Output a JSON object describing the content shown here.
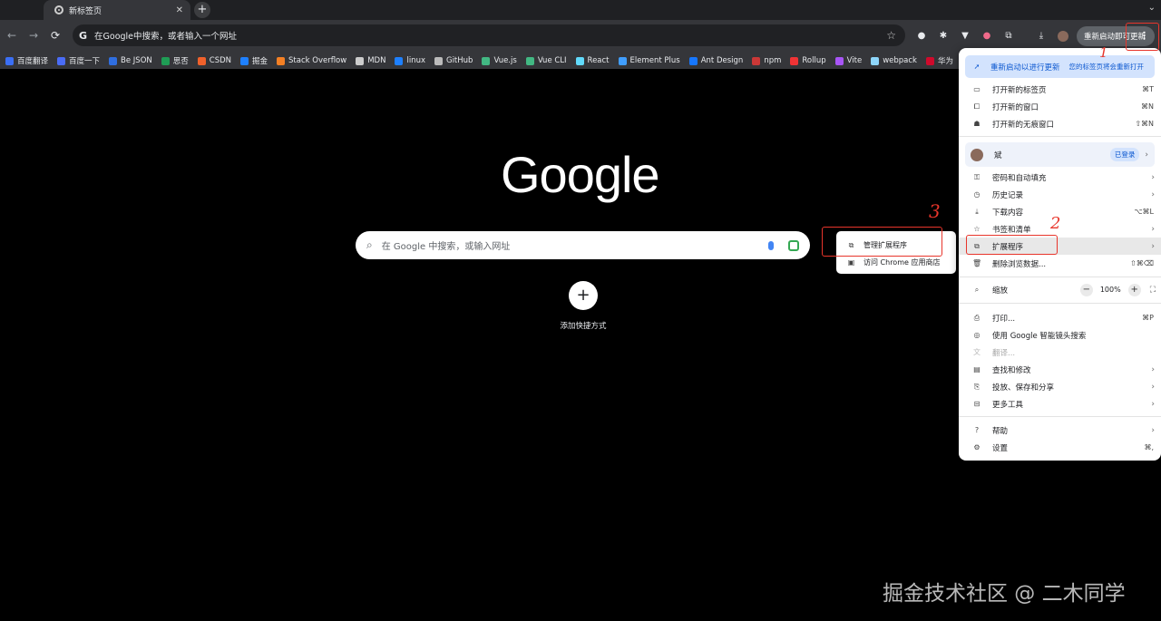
{
  "tab": {
    "title": "新标签页",
    "close": "✕"
  },
  "tabstrip": {
    "new_tab": "+",
    "tab_list": "⌄"
  },
  "toolbar": {
    "back": "←",
    "forward": "→",
    "reload": "⟳",
    "omnibox_g": "G",
    "omnibox_text": "在Google中搜索，或者输入一个网址",
    "star": "☆",
    "update_label": "重新启动即可更新",
    "menu_dots": "⋮"
  },
  "bookmarks": [
    {
      "label": "百度翻译",
      "color": "#3b6ff5"
    },
    {
      "label": "百度一下",
      "color": "#4a6cf7"
    },
    {
      "label": "Be JSON",
      "color": "#2f6ee0"
    },
    {
      "label": "思否",
      "color": "#1f9d55"
    },
    {
      "label": "CSDN",
      "color": "#f0612b"
    },
    {
      "label": "掘金",
      "color": "#1e80ff"
    },
    {
      "label": "Stack Overflow",
      "color": "#f48024"
    },
    {
      "label": "MDN",
      "color": "#cccccc"
    },
    {
      "label": "linux",
      "color": "#1e80ff"
    },
    {
      "label": "GitHub",
      "color": "#bbbbbb"
    },
    {
      "label": "Vue.js",
      "color": "#42b883"
    },
    {
      "label": "Vue CLI",
      "color": "#42b883"
    },
    {
      "label": "React",
      "color": "#61dafb"
    },
    {
      "label": "Element Plus",
      "color": "#409eff"
    },
    {
      "label": "Ant Design",
      "color": "#1677ff"
    },
    {
      "label": "npm",
      "color": "#cb3837"
    },
    {
      "label": "Rollup",
      "color": "#ef3335"
    },
    {
      "label": "Vite",
      "color": "#a855f7"
    },
    {
      "label": "webpack",
      "color": "#8ed6fb"
    },
    {
      "label": "华为",
      "color": "#cf0a2c"
    }
  ],
  "content": {
    "logo": "Google",
    "search_placeholder": "在 Google 中搜索，或输入网址",
    "shortcut_plus": "+",
    "shortcut_label": "添加快捷方式",
    "watermark": "掘金技术社区 @ 二木同学"
  },
  "menu": {
    "relaunch_label": "重新启动以进行更新",
    "relaunch_note": "您的标签页将会重新打开",
    "new_tab": {
      "label": "打开新的标签页",
      "shortcut": "⌘T"
    },
    "new_window": {
      "label": "打开新的窗口",
      "shortcut": "⌘N"
    },
    "incognito": {
      "label": "打开新的无痕窗口",
      "shortcut": "⇧⌘N"
    },
    "profile_name": "斌",
    "signed_in": "已登录",
    "passwords": {
      "label": "密码和自动填充"
    },
    "history": {
      "label": "历史记录"
    },
    "downloads": {
      "label": "下载内容",
      "shortcut": "⌥⌘L"
    },
    "bookmarks_lists": {
      "label": "书签和清单"
    },
    "extensions": {
      "label": "扩展程序"
    },
    "clear_data": {
      "label": "删除浏览数据...",
      "shortcut": "⇧⌘⌫"
    },
    "zoom": {
      "label": "缩放",
      "minus": "−",
      "value": "100%",
      "plus": "+"
    },
    "print": {
      "label": "打印...",
      "shortcut": "⌘P"
    },
    "lens": {
      "label": "使用 Google 智能镜头搜索"
    },
    "translate": {
      "label": "翻译..."
    },
    "find": {
      "label": "查找和修改"
    },
    "cast": {
      "label": "投放、保存和分享"
    },
    "more_tools": {
      "label": "更多工具"
    },
    "help": {
      "label": "帮助"
    },
    "settings": {
      "label": "设置",
      "shortcut": "⌘,"
    },
    "arrow": "›"
  },
  "submenu": {
    "manage_extensions": "管理扩展程序",
    "chrome_store": "访问 Chrome 应用商店"
  },
  "annotations": {
    "n1": "1",
    "n2": "2",
    "n3": "3",
    "color": "#e8352b"
  }
}
